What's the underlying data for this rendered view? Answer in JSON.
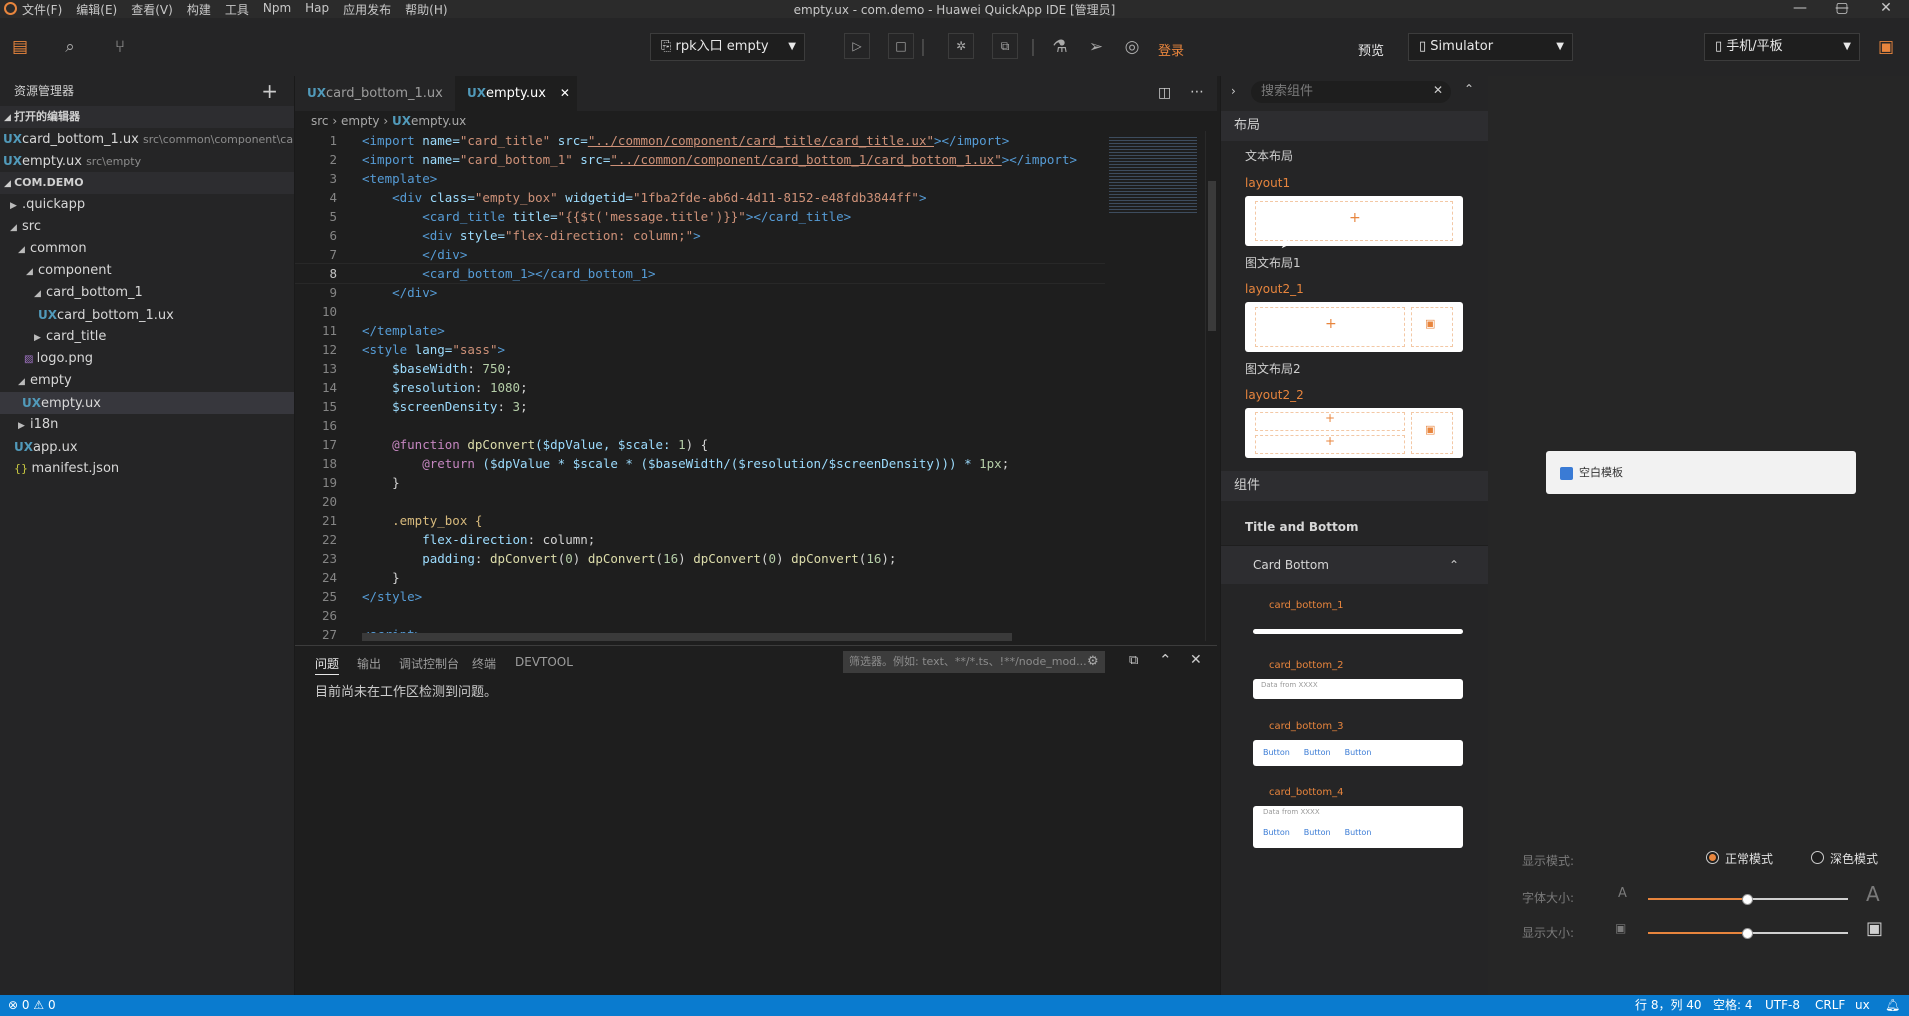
{
  "window": {
    "title": "empty.ux - com.demo - Huawei QuickApp IDE [管理员]",
    "menu": [
      "文件(F)",
      "编辑(E)",
      "查看(V)",
      "构建",
      "工具",
      "Npm",
      "Hap",
      "应用发布",
      "帮助(H)"
    ],
    "controls": [
      "—",
      "▢",
      "✕"
    ]
  },
  "toolbar": {
    "rpk_select": "rpk入口 empty",
    "login": "登录",
    "preview_label": "预览",
    "simulator_select": "Simulator",
    "device_select": "手机/平板"
  },
  "explorer": {
    "header": "资源管理器",
    "open_editors_label": "打开的编辑器",
    "open_editors": [
      {
        "name": "card_bottom_1.ux",
        "path": "src\\common\\component\\card..."
      },
      {
        "name": "empty.ux",
        "path": "src\\empty"
      }
    ],
    "project_label": "COM.DEMO",
    "tree": [
      {
        "label": ".quickapp",
        "kind": "folder"
      },
      {
        "label": "src",
        "kind": "folder"
      },
      {
        "label": "common",
        "kind": "folder"
      },
      {
        "label": "component",
        "kind": "folder"
      },
      {
        "label": "card_bottom_1",
        "kind": "folder"
      },
      {
        "label": "card_bottom_1.ux",
        "kind": "ux"
      },
      {
        "label": "card_title",
        "kind": "folder"
      },
      {
        "label": "logo.png",
        "kind": "image"
      },
      {
        "label": "empty",
        "kind": "folder"
      },
      {
        "label": "empty.ux",
        "kind": "ux"
      },
      {
        "label": "i18n",
        "kind": "folder"
      },
      {
        "label": "app.ux",
        "kind": "ux"
      },
      {
        "label": "manifest.json",
        "kind": "json"
      }
    ]
  },
  "editor": {
    "tabs": [
      {
        "prefix": "UX",
        "label": "card_bottom_1.ux"
      },
      {
        "prefix": "UX",
        "label": "empty.ux"
      }
    ],
    "breadcrumb": [
      "src",
      "empty",
      "empty.ux"
    ],
    "breadcrumb_prefix": "UX",
    "lines": [
      "1",
      "2",
      "3",
      "4",
      "5",
      "6",
      "7",
      "8",
      "9",
      "10",
      "11",
      "12",
      "13",
      "14",
      "15",
      "16",
      "17",
      "18",
      "19",
      "20",
      "21",
      "22",
      "23",
      "24",
      "25",
      "26",
      "27"
    ],
    "code": {
      "l1": [
        "<import ",
        "name=",
        "\"card_title\"",
        " src=",
        "\"../common/component/card_title/card_title.ux\"",
        "></import>"
      ],
      "l2": [
        "<import ",
        "name=",
        "\"card_bottom_1\"",
        " src=",
        "\"../common/component/card_bottom_1/card_bottom_1.ux\"",
        "></import>"
      ],
      "l3": "<template>",
      "l4": [
        "    <div ",
        "class=",
        "\"empty_box\"",
        " widgetid=",
        "\"1fba2fde-ab6d-4d11-8152-e48fdb3844ff\"",
        ">"
      ],
      "l5": [
        "        <card_title ",
        "title=",
        "\"{{$t('message.title')}}\"",
        "></card_title>"
      ],
      "l6": [
        "        <div ",
        "style=",
        "\"flex-direction: column;\"",
        ">"
      ],
      "l7": "        </div>",
      "l8": "        <card_bottom_1></card_bottom_1>",
      "l9": "    </div>",
      "l11": "</template>",
      "l12": [
        "<style ",
        "lang=",
        "\"sass\"",
        ">"
      ],
      "l13": [
        "    $baseWidth",
        ": ",
        "750",
        ";"
      ],
      "l14": [
        "    $resolution",
        ": ",
        "1080",
        ";"
      ],
      "l15": [
        "    $screenDensity",
        ": ",
        "3",
        ";"
      ],
      "l17": [
        "    @function ",
        "dpConvert",
        "($dpValue, $scale: ",
        "1",
        ") {"
      ],
      "l18": [
        "        @return ",
        "($dpValue * $scale * ($baseWidth/($resolution/$screenDensity))) * ",
        "1px",
        ";"
      ],
      "l19": "    }",
      "l21": "    .empty_box {",
      "l22": [
        "        flex-direction",
        ": column;"
      ],
      "l23": [
        "        padding",
        ": ",
        "dpConvert",
        "(",
        "0",
        ") ",
        "dpConvert",
        "(",
        "16",
        ") ",
        "dpConvert",
        "(",
        "0",
        ") ",
        "dpConvert",
        "(",
        "16",
        ");"
      ],
      "l24": "    }",
      "l25": "</style>",
      "l27": "<script>"
    }
  },
  "panel": {
    "tabs": [
      "问题",
      "输出",
      "调试控制台",
      "终端",
      "DEVTOOL"
    ],
    "filter_placeholder": "筛选器。例如: text、**/*.ts、!**/node_mod...",
    "message": "目前尚未在工作区检测到问题。"
  },
  "components": {
    "search_placeholder": "搜索组件",
    "layout_section": "布局",
    "text_layout": "文本布局",
    "layout1": "layout1",
    "img_layout1": "图文布局1",
    "layout2_1": "layout2_1",
    "img_layout2": "图文布局2",
    "layout2_2": "layout2_2",
    "component_section": "组件",
    "title_and_bottom": "Title and Bottom",
    "card_bottom": "Card Bottom",
    "cb1": "card_bottom_1",
    "cb2": "card_bottom_2",
    "cb2_text": "Data from XXXX",
    "cb3": "card_bottom_3",
    "cb3_buttons": [
      "Button",
      "Button",
      "Button"
    ],
    "cb4": "card_bottom_4",
    "cb4_text": "Data from XXXX",
    "cb4_buttons": [
      "Button",
      "Button",
      "Button"
    ]
  },
  "preview": {
    "template_label": "空白模板",
    "display_mode_label": "显示模式:",
    "mode_normal": "正常模式",
    "mode_dark": "深色模式",
    "font_size_label": "字体大小:",
    "display_size_label": "显示大小:",
    "font_small": "A",
    "font_large": "A",
    "font_slider_value": 0.5,
    "display_slider_value": 0.5
  },
  "statusbar": {
    "errors": "0",
    "warnings": "0",
    "position": "行 8，列 40",
    "spaces": "空格: 4",
    "encoding": "UTF-8",
    "eol": "CRLF",
    "language": "ux"
  },
  "colors": {
    "accent": "#e8853d",
    "statusbar": "#0a7bcf",
    "ux_icon": "#519aba"
  }
}
